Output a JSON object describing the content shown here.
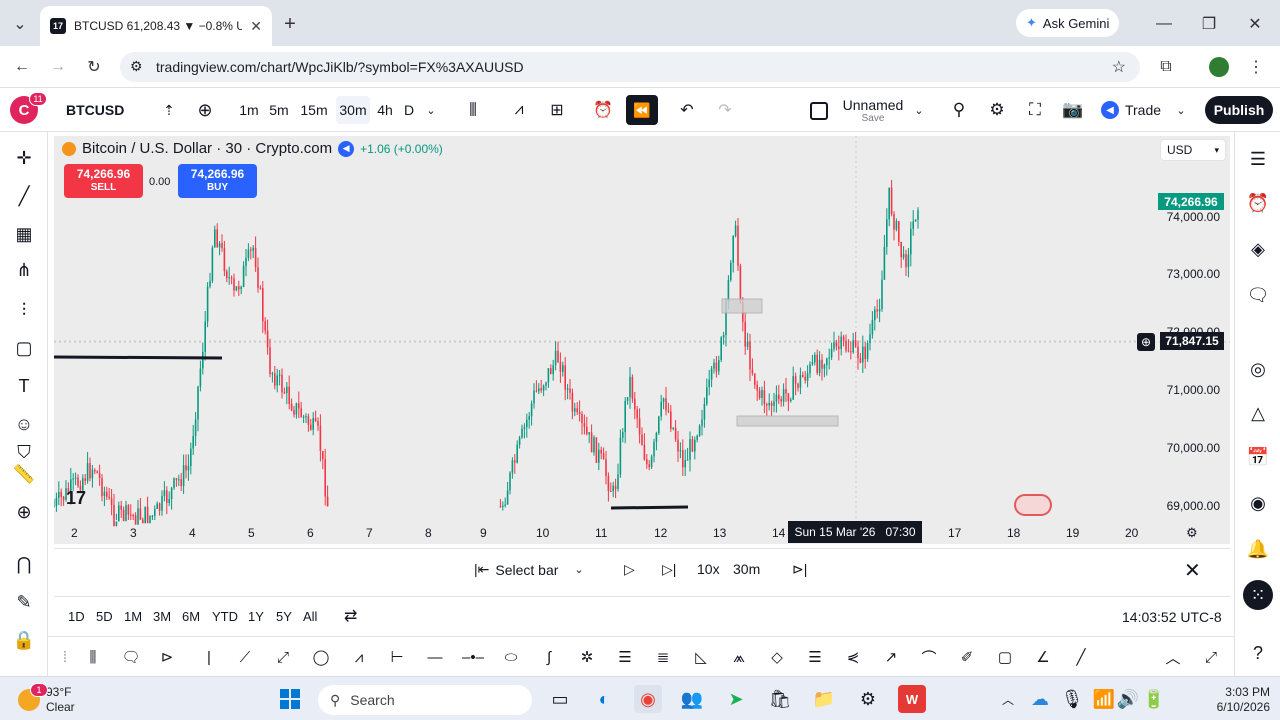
{
  "browser": {
    "tab_title": "BTCUSD 61,208.43 ▼ −0.8% Un",
    "new_tab": "+",
    "ask_gemini": "Ask Gemini",
    "url": "tradingview.com/chart/WpcJiKlb/?symbol=FX%3AXAUUSD"
  },
  "header": {
    "avatar_letter": "C",
    "avatar_badge": "11",
    "symbol": "BTCUSD",
    "intervals": [
      "1m",
      "5m",
      "15m",
      "30m",
      "4h",
      "D"
    ],
    "active_interval": "30m",
    "layout_name": "Unnamed",
    "layout_save": "Save",
    "trade": "Trade",
    "publish": "Publish"
  },
  "chart": {
    "legend_title": "Bitcoin / U.S. Dollar · 30 · Crypto.com",
    "legend_change": "+1.06 (+0.00%)",
    "sell_price": "74,266.96",
    "sell_label": "SELL",
    "buy_price": "74,266.96",
    "buy_label": "BUY",
    "spread": "0.00",
    "currency": "USD",
    "last_price": "74,266.96",
    "crosshair_price": "71,847.15",
    "price_ticks": [
      "74,000.00",
      "73,000.00",
      "72,000.00",
      "71,000.00",
      "70,000.00",
      "69,000.00"
    ],
    "date_ticks": [
      "2",
      "3",
      "4",
      "5",
      "6",
      "7",
      "8",
      "9",
      "10",
      "11",
      "12",
      "13",
      "14",
      "17",
      "18",
      "19",
      "20"
    ],
    "crosshair_date": "Sun 15 Mar '26",
    "crosshair_time": "07:30",
    "colors": {
      "up": "#089981",
      "down": "#f23645"
    }
  },
  "replay": {
    "select_bar": "Select bar",
    "speed": "10x",
    "step": "30m"
  },
  "timeframes": {
    "ranges": [
      "1D",
      "5D",
      "1M",
      "3M",
      "6M",
      "YTD",
      "1Y",
      "5Y",
      "All"
    ],
    "clock": "14:03:52 UTC-8"
  },
  "taskbar": {
    "weather_temp": "93°F",
    "weather_desc": "Clear",
    "weather_badge": "1",
    "search": "Search",
    "time": "3:03 PM",
    "date": "6/10/2026"
  }
}
